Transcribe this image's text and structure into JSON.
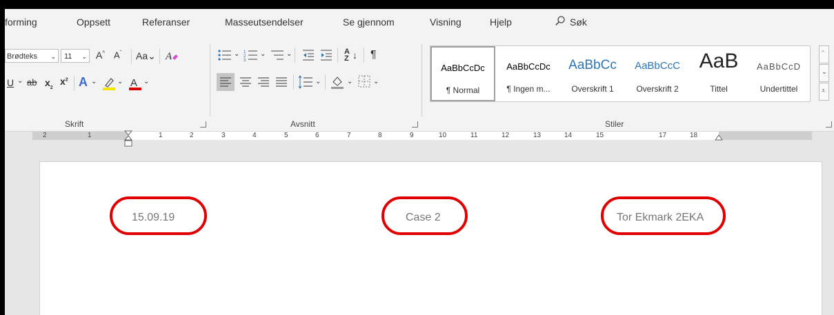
{
  "menu": {
    "items": [
      "forming",
      "Oppsett",
      "Referanser",
      "Masseutsendelser",
      "Se gjennom",
      "Visning",
      "Hjelp"
    ],
    "search_label": "Søk"
  },
  "ribbon": {
    "font": {
      "font_name": "Brødteks",
      "font_size": "11",
      "group_label": "Skrift"
    },
    "paragraph": {
      "group_label": "Avsnitt"
    },
    "styles": {
      "group_label": "Stiler",
      "tiles": [
        {
          "sample": "AaBbCcDc",
          "name": "¶ Normal"
        },
        {
          "sample": "AaBbCcDc",
          "name": "¶ Ingen m..."
        },
        {
          "sample": "AaBbCc",
          "name": "Overskrift 1"
        },
        {
          "sample": "AaBbCcC",
          "name": "Overskrift 2"
        },
        {
          "sample": "AaB",
          "name": "Tittel"
        },
        {
          "sample": "AaBbCcD",
          "name": "Undertittel"
        }
      ]
    }
  },
  "ruler": {
    "left_numbers": [
      "2",
      "1"
    ],
    "right_numbers": [
      "1",
      "2",
      "3",
      "4",
      "5",
      "6",
      "7",
      "8",
      "9",
      "10",
      "11",
      "12",
      "13",
      "14",
      "15",
      "17",
      "18"
    ]
  },
  "document": {
    "header_left": "15.09.19",
    "header_center": "Case 2",
    "header_right": "Tor Ekmark 2EKA"
  },
  "colors": {
    "annotation": "#e00000",
    "font_color_bar": "#e00000",
    "highlight_bar": "#f5e400",
    "style_heading": "#2e74b5"
  }
}
